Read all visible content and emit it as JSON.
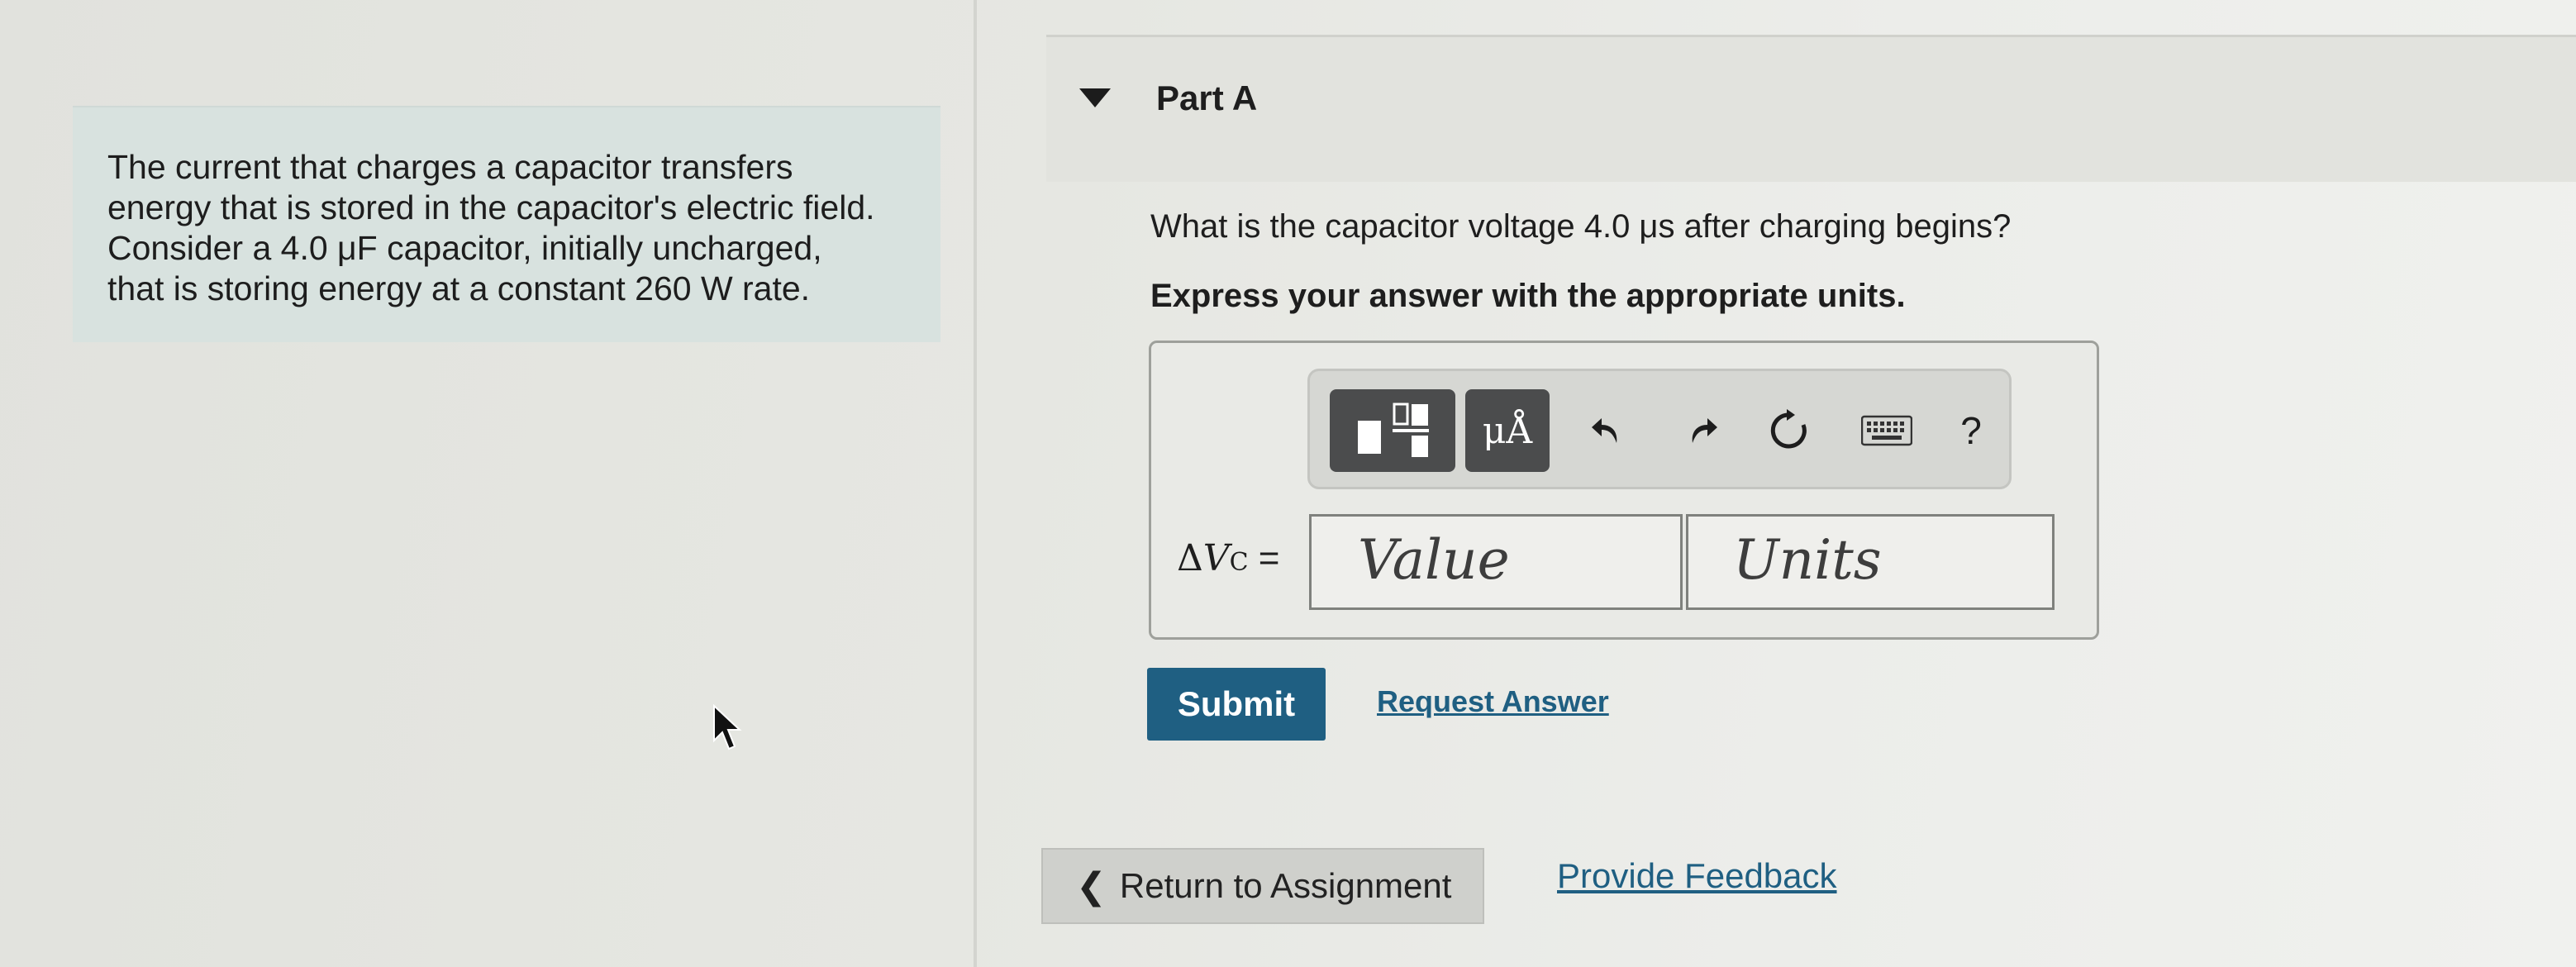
{
  "context": {
    "text_lines": [
      "The current that charges a capacitor transfers",
      "energy that is stored in the capacitor's electric field.",
      "Consider a 4.0 μF capacitor, initially uncharged,",
      "that is storing energy at a constant 260 W rate."
    ]
  },
  "part": {
    "title": "Part A",
    "question": "What is the capacitor voltage 4.0 μs after charging begins?",
    "instruction": "Express your answer with the appropriate units."
  },
  "toolbar": {
    "units_label": "μÅ",
    "help_label": "?",
    "icons": [
      "templates-icon",
      "units-icon",
      "undo-icon",
      "redo-icon",
      "reset-icon",
      "keyboard-icon",
      "help-icon"
    ]
  },
  "answer": {
    "label_delta": "Δ",
    "label_v": "V",
    "label_sub": "C",
    "label_eq": " =",
    "value_placeholder": "Value",
    "units_placeholder": "Units"
  },
  "buttons": {
    "submit": "Submit",
    "request_answer": "Request Answer",
    "return_to_assignment": "Return to Assignment",
    "provide_feedback": "Provide Feedback"
  },
  "colors": {
    "accent": "#1f5f82",
    "context_bg": "#d8e2df",
    "toolbar_button_bg": "#4b4c4d"
  }
}
